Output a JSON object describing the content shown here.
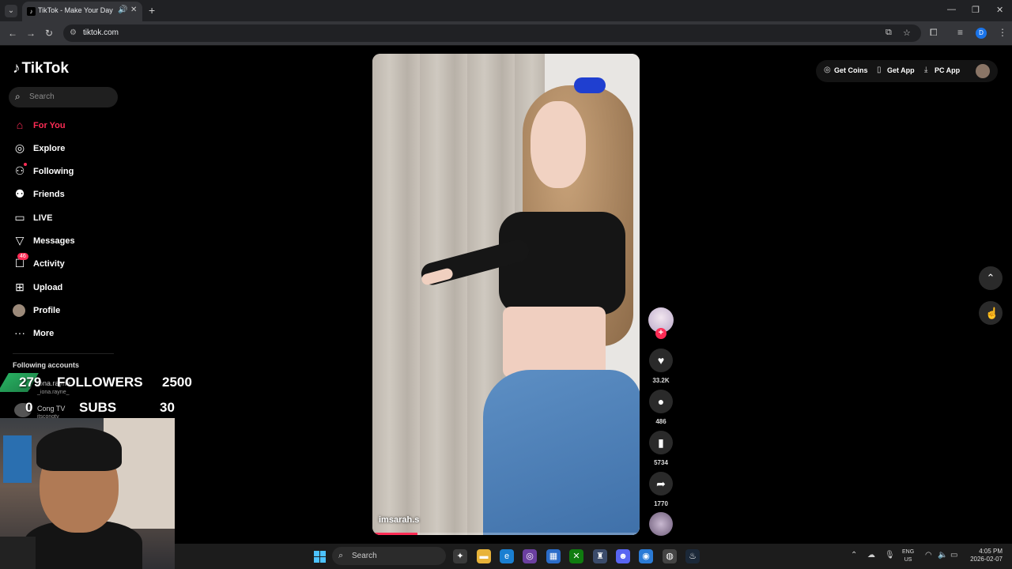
{
  "browser": {
    "tab_title": "TikTok - Make Your Day",
    "url": "tiktok.com",
    "profile_initial": "D"
  },
  "tiktok": {
    "logo": "TikTok",
    "search_placeholder": "Search",
    "menu": [
      {
        "label": "For You",
        "icon": "home-icon",
        "active": true
      },
      {
        "label": "Explore",
        "icon": "compass-icon"
      },
      {
        "label": "Following",
        "icon": "following-icon"
      },
      {
        "label": "Friends",
        "icon": "friends-icon"
      },
      {
        "label": "LIVE",
        "icon": "live-icon"
      },
      {
        "label": "Messages",
        "icon": "messages-icon"
      },
      {
        "label": "Activity",
        "icon": "activity-icon",
        "badge": "46"
      },
      {
        "label": "Upload",
        "icon": "upload-icon"
      },
      {
        "label": "Profile",
        "icon": "avatar"
      },
      {
        "label": "More",
        "icon": "more-icon"
      }
    ],
    "following_title": "Following accounts",
    "following_accounts": [
      {
        "name": "iona.rayne",
        "handle": "_iona.rayne_"
      },
      {
        "name": "Cong TV",
        "handle": "itscongtv"
      }
    ],
    "top_right": {
      "coins": "Get Coins",
      "app": "Get App",
      "pc": "PC App"
    },
    "video": {
      "username": "imsarah.s",
      "progress": 0.17,
      "likes": "33.2K",
      "comments": "486",
      "saves": "5734",
      "shares": "1770"
    }
  },
  "overlay": {
    "followers_count": "279",
    "followers_label": "FOLLOWERS",
    "followers_goal": "2500",
    "subs_count": "0",
    "subs_label": "SUBS",
    "subs_goal": "30"
  },
  "taskbar": {
    "search_placeholder": "Search",
    "lang_top": "ENG",
    "lang_bottom": "US",
    "time": "4:05 PM",
    "date": "2026-02-07"
  },
  "colors": {
    "accent": "#fe2c55",
    "overlay_green": "#27ae60"
  }
}
